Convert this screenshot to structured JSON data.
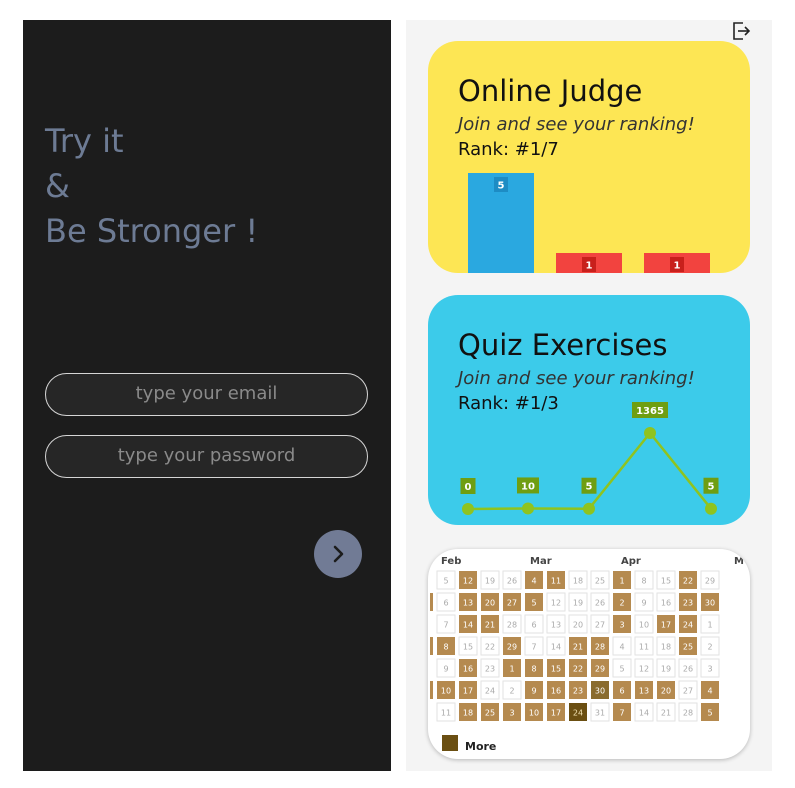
{
  "login": {
    "tagline_lines": [
      "Try it",
      "&",
      "Be Stronger !"
    ],
    "email_placeholder": "type your email",
    "password_placeholder": "type your password"
  },
  "dashboard": {
    "cards": [
      {
        "title": "Online Judge",
        "subtitle": "Join and see your ranking!",
        "rank": "Rank: #1/7",
        "chart_type": "bar",
        "values": [
          5,
          1,
          1
        ],
        "colors": [
          "#2aa8e0",
          "#f2433f",
          "#f2433f"
        ],
        "background": "#fde654"
      },
      {
        "title": "Quiz Exercises",
        "subtitle": "Join and see your ranking!",
        "rank": "Rank: #1/3",
        "chart_type": "line",
        "values": [
          0,
          10,
          5,
          1365,
          5
        ],
        "color": "#8fc31f",
        "background": "#3ccbea"
      }
    ],
    "heatmap": {
      "months": [
        "Feb",
        "Mar",
        "Apr",
        "M"
      ],
      "legend_label": "More",
      "days": [
        [
          "5",
          "6",
          "7",
          "8",
          "9",
          "10",
          "11"
        ],
        [
          "12",
          "13",
          "14",
          "15",
          "16",
          "17",
          "18"
        ],
        [
          "19",
          "20",
          "21",
          "22",
          "23",
          "24",
          "25"
        ],
        [
          "26",
          "27",
          "28",
          "29",
          "1",
          "2",
          "3"
        ],
        [
          "4",
          "5",
          "6",
          "7",
          "8",
          "9",
          "10"
        ],
        [
          "11",
          "12",
          "13",
          "14",
          "15",
          "16",
          "17"
        ],
        [
          "18",
          "19",
          "20",
          "21",
          "22",
          "23",
          "24"
        ],
        [
          "25",
          "26",
          "27",
          "28",
          "29",
          "30",
          "31"
        ],
        [
          "1",
          "2",
          "3",
          "4",
          "5",
          "6",
          "7"
        ],
        [
          "8",
          "9",
          "10",
          "11",
          "12",
          "13",
          "14"
        ],
        [
          "15",
          "16",
          "17",
          "18",
          "19",
          "20",
          "21"
        ],
        [
          "22",
          "23",
          "24",
          "25",
          "26",
          "27",
          "28"
        ],
        [
          "29",
          "30",
          "1",
          "2",
          "3",
          "4",
          "5"
        ]
      ],
      "levels": [
        [
          0,
          0,
          0,
          2,
          0,
          2,
          0
        ],
        [
          2,
          2,
          2,
          0,
          2,
          2,
          2
        ],
        [
          0,
          2,
          2,
          0,
          0,
          0,
          2
        ],
        [
          0,
          2,
          0,
          2,
          2,
          0,
          2
        ],
        [
          2,
          2,
          0,
          0,
          2,
          2,
          2
        ],
        [
          2,
          0,
          0,
          0,
          2,
          2,
          2
        ],
        [
          0,
          0,
          0,
          2,
          2,
          2,
          3
        ],
        [
          0,
          0,
          0,
          2,
          2,
          1,
          0
        ],
        [
          2,
          2,
          2,
          0,
          0,
          2,
          2
        ],
        [
          0,
          0,
          0,
          0,
          0,
          2,
          0
        ],
        [
          0,
          0,
          2,
          0,
          0,
          2,
          0
        ],
        [
          2,
          2,
          2,
          2,
          0,
          0,
          0
        ],
        [
          0,
          2,
          0,
          0,
          0,
          2,
          2
        ]
      ],
      "level_colors": [
        "#ffffff",
        "#8a6c2e",
        "#b58a4f",
        "#6b4f12"
      ]
    }
  }
}
